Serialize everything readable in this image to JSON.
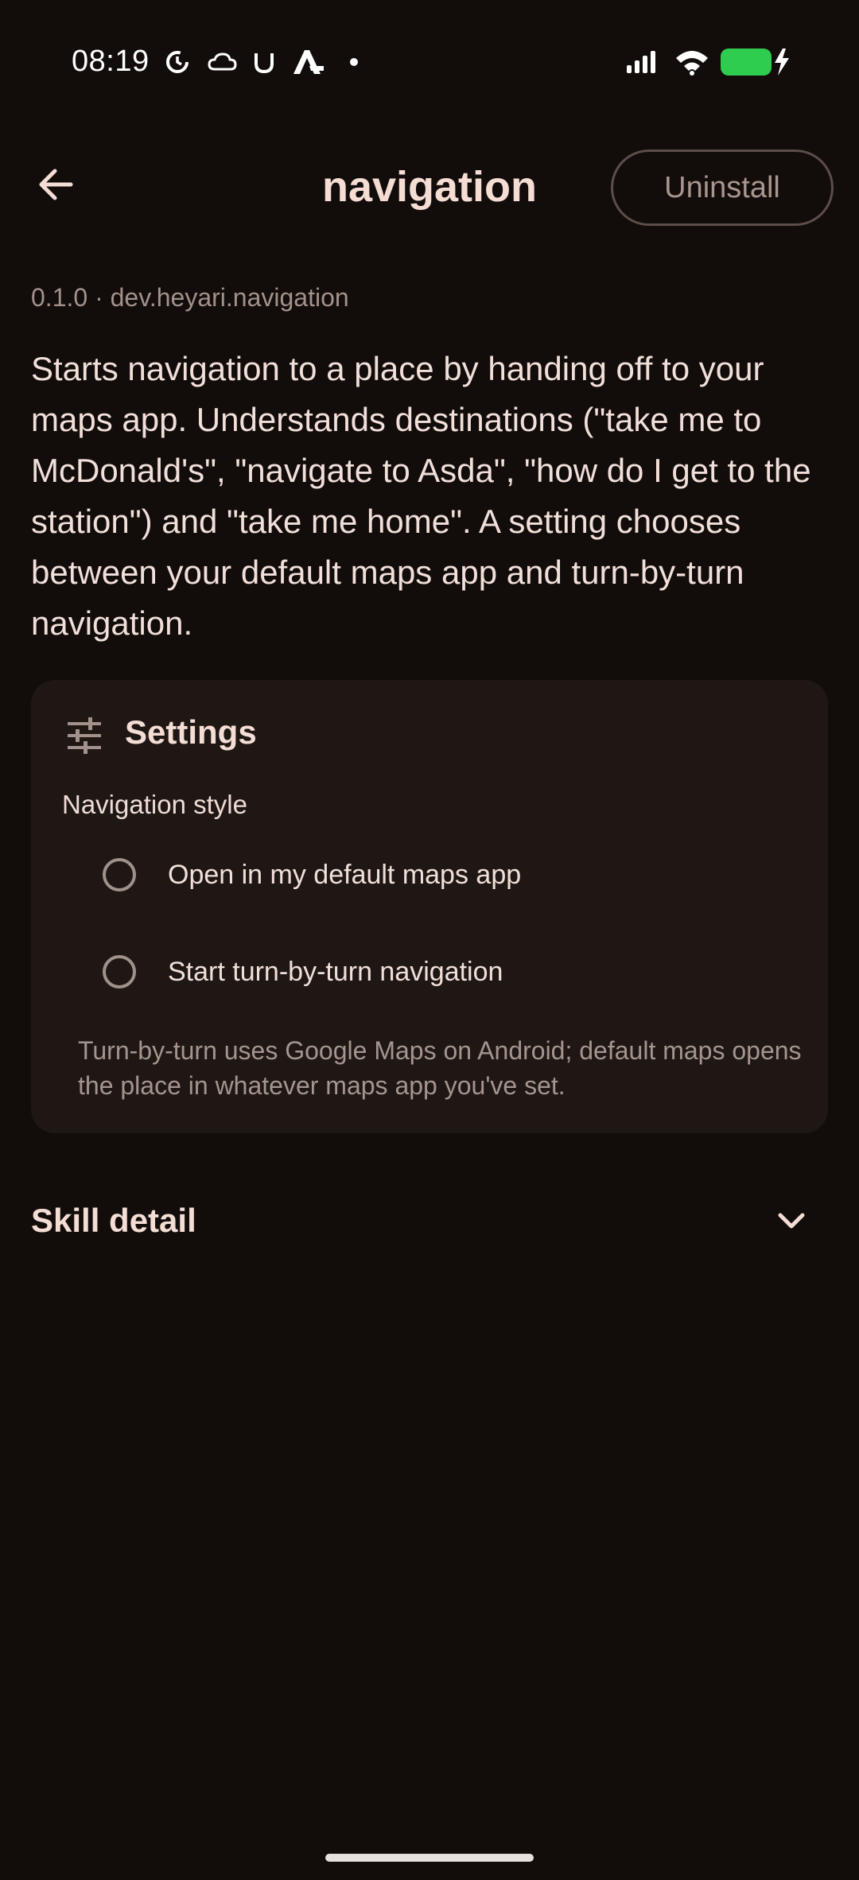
{
  "status_bar": {
    "time": "08:19",
    "left_icons": [
      "sync-icon",
      "cloud-icon",
      "magnet-icon",
      "a-icon",
      "dot-icon"
    ],
    "right_icons": [
      "signal-icon",
      "wifi-icon",
      "battery-charging-icon"
    ],
    "battery_color": "#2ecc4f"
  },
  "header": {
    "title": "navigation",
    "uninstall_label": "Uninstall"
  },
  "meta": "0.1.0 · dev.heyari.navigation",
  "description": "Starts navigation to a place by handing off to your maps app. Understands destinations (\"take me to McDonald's\", \"navigate to Asda\", \"how do I get to the station\") and \"take me home\". A setting chooses between your default maps app and turn-by-turn navigation.",
  "settings": {
    "title": "Settings",
    "navigation_style_label": "Navigation style",
    "options": [
      {
        "label": "Open in my default maps app",
        "selected": false
      },
      {
        "label": "Start turn-by-turn navigation",
        "selected": false
      }
    ],
    "hint": "Turn-by-turn uses Google Maps on Android; default maps opens the place in whatever maps app you've set."
  },
  "skill_detail": {
    "label": "Skill detail",
    "expanded": false
  }
}
